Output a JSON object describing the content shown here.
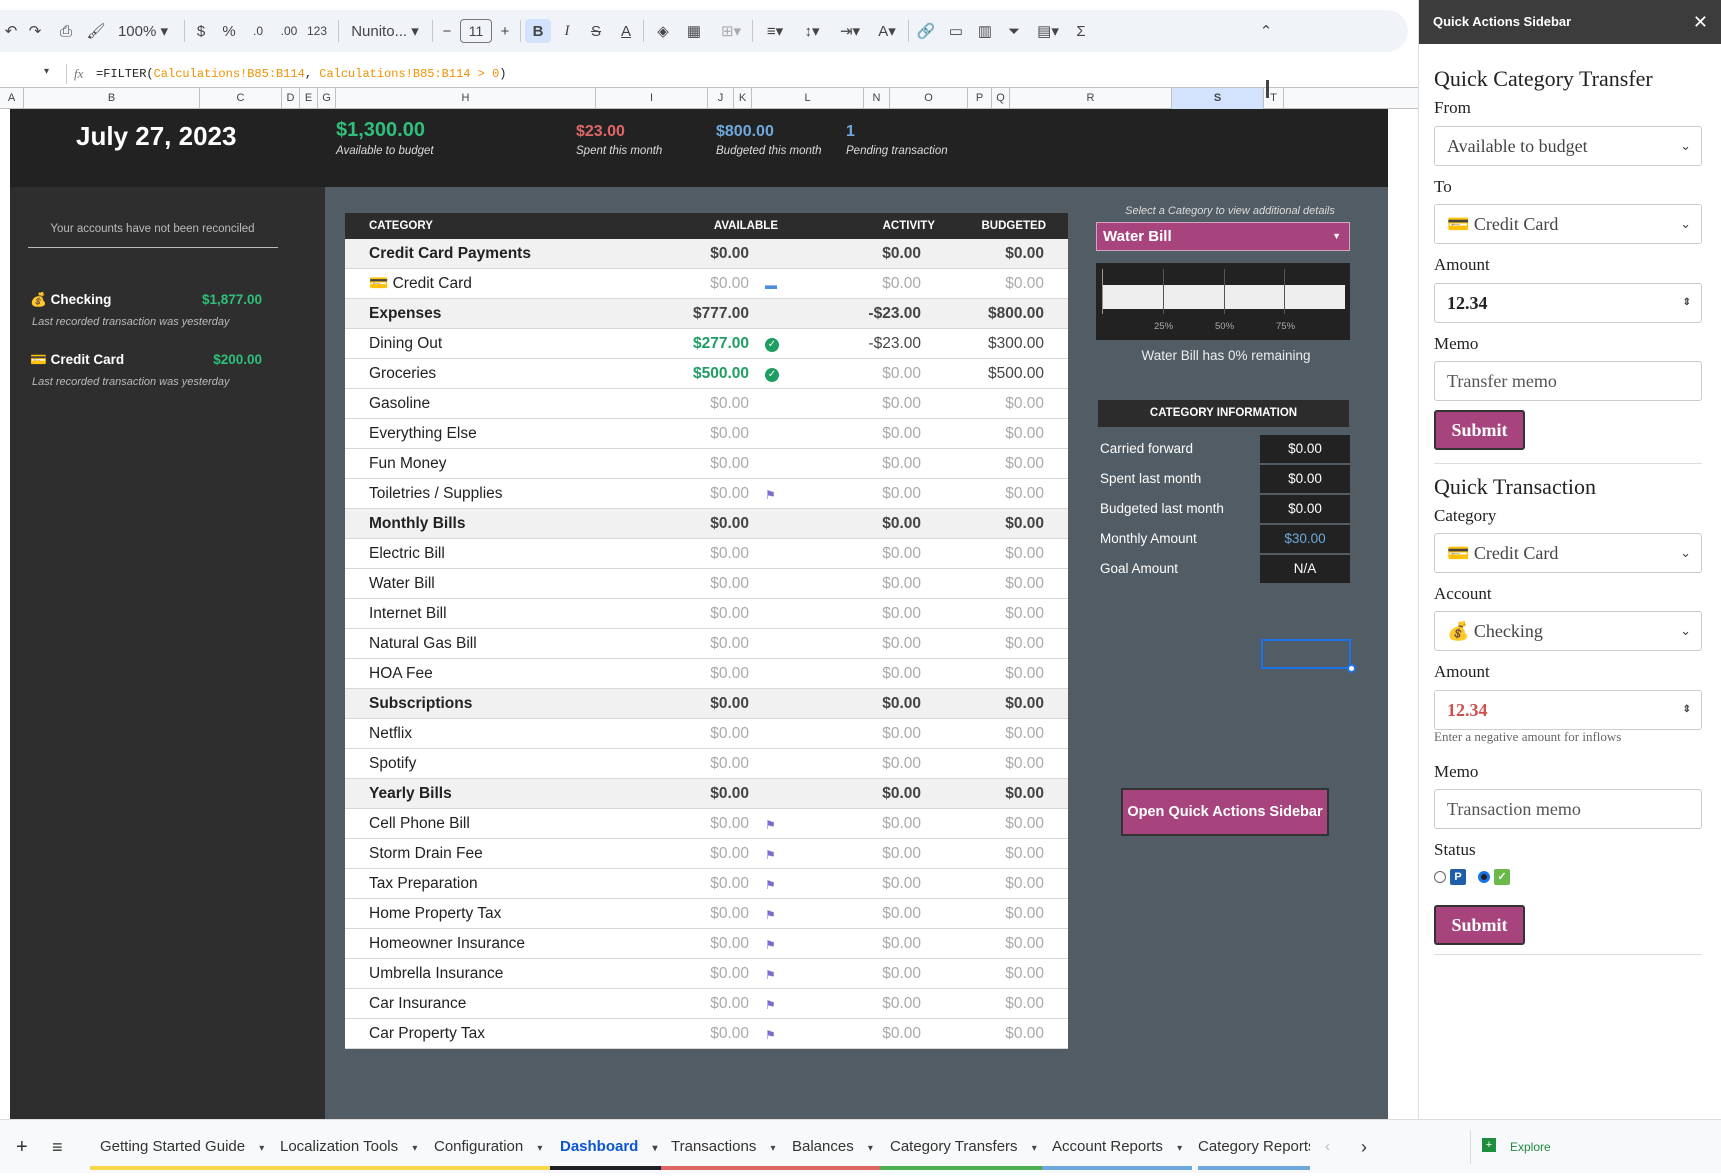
{
  "toolbar": {
    "zoom": "100%",
    "currency": "$",
    "percent": "%",
    "dec_decrease": ".0",
    "dec_increase": ".00",
    "number_format": "123",
    "font": "Nunito...",
    "font_size": "11",
    "bold": "B",
    "italic": "I",
    "sigma": "Σ"
  },
  "formula_bar": {
    "cell_ref": "",
    "fx": "fx",
    "formula_prefix": "=FILTER(",
    "arg1": "Calculations!B85:B114",
    "sep": ", ",
    "arg2": "Calculations!B85:B114 > 0",
    "formula_suffix": ")"
  },
  "columns": [
    "A",
    "B",
    "C",
    "D",
    "E",
    "G",
    "H",
    "I",
    "J",
    "K",
    "L",
    "N",
    "O",
    "P",
    "Q",
    "R",
    "S",
    "T"
  ],
  "summary": {
    "date": "July 27, 2023",
    "available_amount": "$1,300.00",
    "available_label": "Available to budget",
    "spent_amount": "$23.00",
    "spent_label": "Spent this month",
    "budgeted_amount": "$800.00",
    "budgeted_label": "Budgeted this month",
    "pending_count": "1",
    "pending_label": "Pending transaction"
  },
  "accounts": {
    "notice": "Your accounts have not been reconciled",
    "items": [
      {
        "icon": "💰",
        "name": "Checking",
        "amount": "$1,877.00",
        "sub": "Last recorded transaction was yesterday"
      },
      {
        "icon": "💳",
        "name": "Credit Card",
        "amount": "$200.00",
        "sub": "Last recorded transaction was yesterday"
      }
    ]
  },
  "table": {
    "headers": {
      "category": "CATEGORY",
      "available": "AVAILABLE",
      "activity": "ACTIVITY",
      "budgeted": "BUDGETED"
    },
    "rows": [
      {
        "type": "grp",
        "name": "Credit Card Payments",
        "available": "$0.00",
        "activity": "$0.00",
        "budgeted": "$0.00",
        "icon": ""
      },
      {
        "type": "item",
        "name": "💳 Credit Card",
        "available": "$0.00",
        "activity": "$0.00",
        "budgeted": "$0.00",
        "icon": "card"
      },
      {
        "type": "grp",
        "name": "Expenses",
        "available": "$777.00",
        "activity": "-$23.00",
        "budgeted": "$800.00",
        "icon": ""
      },
      {
        "type": "item",
        "name": "Dining Out",
        "available": "$277.00",
        "activity": "-$23.00",
        "budgeted": "$300.00",
        "icon": "check",
        "avail_style": "green",
        "act_style": "dark",
        "bud_style": "dark"
      },
      {
        "type": "item",
        "name": "Groceries",
        "available": "$500.00",
        "activity": "$0.00",
        "budgeted": "$500.00",
        "icon": "check",
        "avail_style": "green",
        "bud_style": "dark"
      },
      {
        "type": "item",
        "name": "Gasoline",
        "available": "$0.00",
        "activity": "$0.00",
        "budgeted": "$0.00",
        "icon": ""
      },
      {
        "type": "item",
        "name": "Everything Else",
        "available": "$0.00",
        "activity": "$0.00",
        "budgeted": "$0.00",
        "icon": ""
      },
      {
        "type": "item",
        "name": "Fun Money",
        "available": "$0.00",
        "activity": "$0.00",
        "budgeted": "$0.00",
        "icon": ""
      },
      {
        "type": "item",
        "name": "Toiletries / Supplies",
        "available": "$0.00",
        "activity": "$0.00",
        "budgeted": "$0.00",
        "icon": "flag"
      },
      {
        "type": "grp",
        "name": "Monthly Bills",
        "available": "$0.00",
        "activity": "$0.00",
        "budgeted": "$0.00",
        "icon": ""
      },
      {
        "type": "item",
        "name": "Electric Bill",
        "available": "$0.00",
        "activity": "$0.00",
        "budgeted": "$0.00",
        "icon": ""
      },
      {
        "type": "item",
        "name": "Water Bill",
        "available": "$0.00",
        "activity": "$0.00",
        "budgeted": "$0.00",
        "icon": ""
      },
      {
        "type": "item",
        "name": "Internet Bill",
        "available": "$0.00",
        "activity": "$0.00",
        "budgeted": "$0.00",
        "icon": ""
      },
      {
        "type": "item",
        "name": "Natural Gas Bill",
        "available": "$0.00",
        "activity": "$0.00",
        "budgeted": "$0.00",
        "icon": ""
      },
      {
        "type": "item",
        "name": "HOA Fee",
        "available": "$0.00",
        "activity": "$0.00",
        "budgeted": "$0.00",
        "icon": ""
      },
      {
        "type": "grp",
        "name": "Subscriptions",
        "available": "$0.00",
        "activity": "$0.00",
        "budgeted": "$0.00",
        "icon": ""
      },
      {
        "type": "item",
        "name": "Netflix",
        "available": "$0.00",
        "activity": "$0.00",
        "budgeted": "$0.00",
        "icon": ""
      },
      {
        "type": "item",
        "name": "Spotify",
        "available": "$0.00",
        "activity": "$0.00",
        "budgeted": "$0.00",
        "icon": ""
      },
      {
        "type": "grp",
        "name": "Yearly Bills",
        "available": "$0.00",
        "activity": "$0.00",
        "budgeted": "$0.00",
        "icon": ""
      },
      {
        "type": "item",
        "name": "Cell Phone Bill",
        "available": "$0.00",
        "activity": "$0.00",
        "budgeted": "$0.00",
        "icon": "flag"
      },
      {
        "type": "item",
        "name": "Storm Drain Fee",
        "available": "$0.00",
        "activity": "$0.00",
        "budgeted": "$0.00",
        "icon": "flag"
      },
      {
        "type": "item",
        "name": "Tax Preparation",
        "available": "$0.00",
        "activity": "$0.00",
        "budgeted": "$0.00",
        "icon": "flag"
      },
      {
        "type": "item",
        "name": "Home Property Tax",
        "available": "$0.00",
        "activity": "$0.00",
        "budgeted": "$0.00",
        "icon": "flag"
      },
      {
        "type": "item",
        "name": "Homeowner Insurance",
        "available": "$0.00",
        "activity": "$0.00",
        "budgeted": "$0.00",
        "icon": "flag"
      },
      {
        "type": "item",
        "name": "Umbrella Insurance",
        "available": "$0.00",
        "activity": "$0.00",
        "budgeted": "$0.00",
        "icon": "flag"
      },
      {
        "type": "item",
        "name": "Car Insurance",
        "available": "$0.00",
        "activity": "$0.00",
        "budgeted": "$0.00",
        "icon": "flag"
      },
      {
        "type": "item",
        "name": "Car Property Tax",
        "available": "$0.00",
        "activity": "$0.00",
        "budgeted": "$0.00",
        "icon": "flag"
      }
    ]
  },
  "details": {
    "hint": "Select a Category to view additional details",
    "selected": "Water Bill",
    "bar_fraction": 0,
    "ticks": [
      "25%",
      "50%",
      "75%"
    ],
    "remaining_text": "Water Bill has 0% remaining",
    "info_title": "CATEGORY INFORMATION",
    "info": [
      {
        "label": "Carried forward",
        "value": "$0.00"
      },
      {
        "label": "Spent last month",
        "value": "$0.00"
      },
      {
        "label": "Budgeted last month",
        "value": "$0.00"
      },
      {
        "label": "Monthly Amount",
        "value": "$30.00",
        "accent": true
      },
      {
        "label": "Goal Amount",
        "value": "N/A"
      }
    ],
    "open_sidebar_button": "Open Quick Actions Sidebar"
  },
  "sidebar": {
    "title": "Quick Actions Sidebar",
    "transfer": {
      "heading": "Quick Category Transfer",
      "from_label": "From",
      "from_value": "Available to budget",
      "to_label": "To",
      "to_value": "💳 Credit Card",
      "amount_label": "Amount",
      "amount_value": "12.34",
      "memo_label": "Memo",
      "memo_placeholder": "Transfer memo",
      "submit": "Submit"
    },
    "transaction": {
      "heading": "Quick Transaction",
      "category_label": "Category",
      "category_value": "💳 Credit Card",
      "account_label": "Account",
      "account_value": "💰 Checking",
      "amount_label": "Amount",
      "amount_value": "12.34",
      "amount_hint": "Enter a negative amount for inflows",
      "memo_label": "Memo",
      "memo_placeholder": "Transaction memo",
      "status_label": "Status",
      "status_p": "P",
      "status_check": "✓",
      "submit": "Submit"
    }
  },
  "tabs": [
    {
      "label": "Getting Started Guide",
      "color": "#f6d84a",
      "active": false
    },
    {
      "label": "Localization Tools",
      "color": "#f6d84a",
      "active": false
    },
    {
      "label": "Configuration",
      "color": "#f6d84a",
      "active": false
    },
    {
      "label": "Dashboard",
      "color": "#202124",
      "active": true
    },
    {
      "label": "Transactions",
      "color": "#e06666",
      "active": false
    },
    {
      "label": "Balances",
      "color": "#e06666",
      "active": false
    },
    {
      "label": "Category Transfers",
      "color": "#4caf50",
      "active": false
    },
    {
      "label": "Account Reports",
      "color": "#6fa8dc",
      "active": false
    },
    {
      "label": "Category Reports",
      "color": "#6fa8dc",
      "active": false
    }
  ],
  "explore_label": "Explore",
  "colors": {
    "accent_magenta": "#a8447d",
    "green": "#1e9e62",
    "red": "#e06666",
    "blue": "#6fa8dc"
  }
}
